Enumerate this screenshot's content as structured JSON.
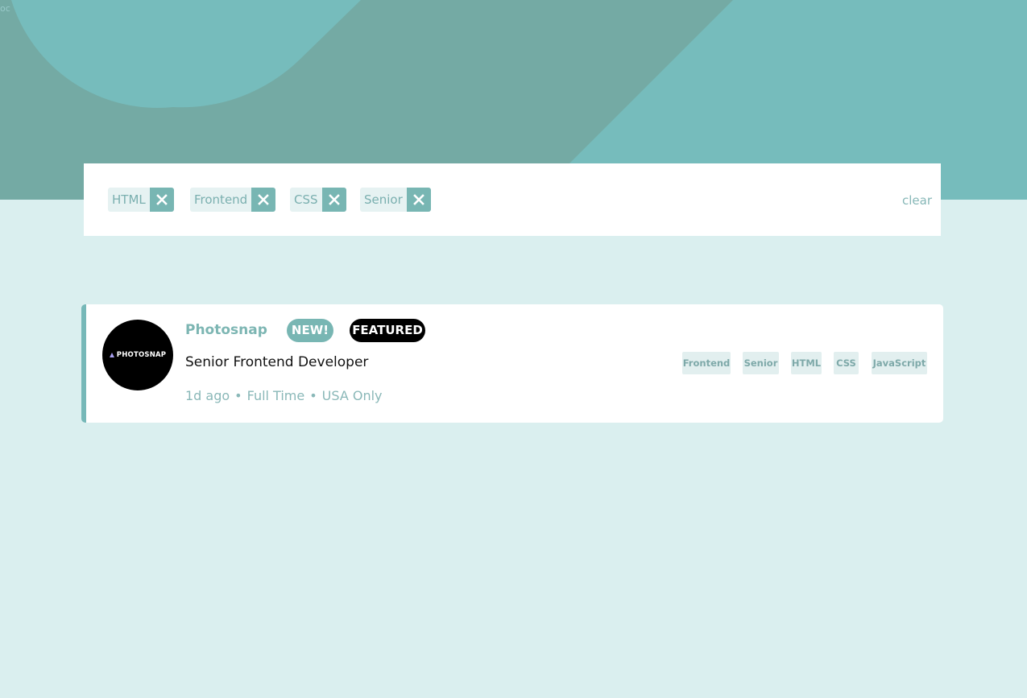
{
  "corner_text": "oc",
  "filters": {
    "chips": [
      {
        "label": "HTML"
      },
      {
        "label": "Frontend"
      },
      {
        "label": "CSS"
      },
      {
        "label": "Senior"
      }
    ],
    "clear_label": "clear"
  },
  "job": {
    "logo_text": "PHOTOSNAP",
    "company": "Photosnap",
    "badges": {
      "new": "NEW!",
      "featured": "FEATURED"
    },
    "position": "Senior Frontend Developer",
    "meta": {
      "posted": "1d ago",
      "sep1": "•",
      "contract": "Full Time",
      "sep2": "•",
      "location": "USA Only"
    },
    "tags": [
      "Frontend",
      "Senior",
      "HTML",
      "CSS",
      "JavaScript"
    ]
  },
  "colors": {
    "accent": "#76b8b8",
    "background": "#daefef",
    "header_dark": "#74aaa4",
    "header_light": "#76bcbc"
  }
}
